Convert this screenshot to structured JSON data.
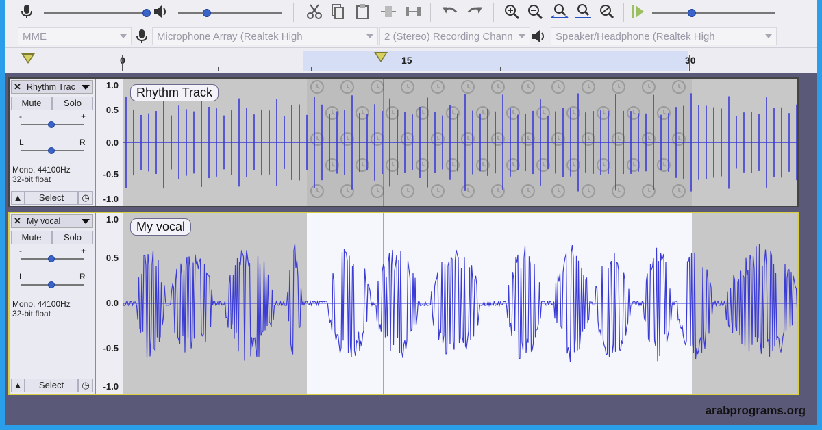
{
  "toolbar": {
    "icons": [
      "microphone-icon",
      "speaker-icon",
      "cut-icon",
      "copy-icon",
      "paste-icon",
      "trim-icon",
      "silence-icon",
      "undo-icon",
      "redo-icon",
      "zoom-in-icon",
      "zoom-out-icon",
      "fit-selection-icon",
      "fit-project-icon",
      "zoom-toggle-icon",
      "play-at-speed-icon"
    ]
  },
  "devices": {
    "host": "MME",
    "recording_device": "Microphone Array (Realtek High",
    "channels": "2 (Stereo) Recording Chann",
    "playback_device": "Speaker/Headphone (Realtek High"
  },
  "ruler": {
    "labels": [
      "0",
      "15",
      "30"
    ],
    "selection_start_s": 9.5,
    "selection_end_s": 30
  },
  "tracks": [
    {
      "title": "Rhythm Track",
      "title_short": "Rhythm Trac",
      "clip_label": "Rhythm Track",
      "mute": "Mute",
      "solo": "Solo",
      "gain_label_minus": "-",
      "gain_label_plus": "+",
      "pan_left": "L",
      "pan_right": "R",
      "format_line1": "Mono, 44100Hz",
      "format_line2": "32-bit float",
      "select": "Select",
      "scale": [
        "1.0",
        "0.5",
        "0.0",
        "-0.5",
        "-1.0"
      ]
    },
    {
      "title": "My vocal",
      "title_short": "My vocal",
      "clip_label": "My vocal",
      "mute": "Mute",
      "solo": "Solo",
      "gain_label_minus": "-",
      "gain_label_plus": "+",
      "pan_left": "L",
      "pan_right": "R",
      "format_line1": "Mono, 44100Hz",
      "format_line2": "32-bit float",
      "select": "Select",
      "scale": [
        "1.0",
        "0.5",
        "0.0",
        "-0.5",
        "-1.0"
      ]
    }
  ],
  "watermark": "arabprograms.org",
  "colors": {
    "waveform": "#3b3bd6",
    "selection": "#f5f7fc",
    "track_bg": "#c8c8c8",
    "accent": "#2a9ee8"
  }
}
